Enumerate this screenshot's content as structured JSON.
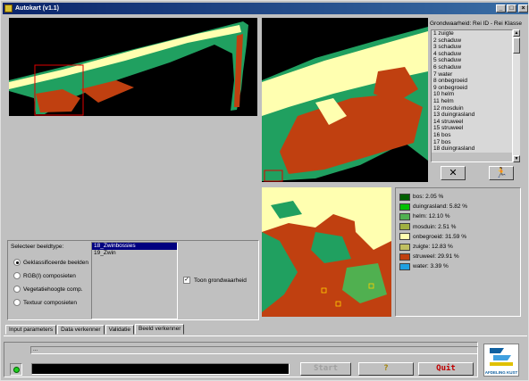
{
  "window": {
    "title": "Autokart (v1.1)",
    "minimize": "_",
    "maximize": "□",
    "close": "×"
  },
  "class_list": {
    "label": "Grondwaarheid: Rei ID - Rei Klasse",
    "items": [
      "1 zuigte",
      "2 schaduw",
      "3 schaduw",
      "4 schaduw",
      "5 schaduw",
      "6 schaduw",
      "7 water",
      "8 onbegroeid",
      "9 onbegroeid",
      "10 helm",
      "11 helm",
      "12 mosduin",
      "13 duingrasland",
      "14 struweel",
      "15 struweel",
      "16 bos",
      "17 bos",
      "18 duingrasland"
    ],
    "clear_button": "✕",
    "run_button": "🏃"
  },
  "legend": {
    "items": [
      {
        "label": "bos: 2.05 %",
        "color": "#006000"
      },
      {
        "label": "duingrasland: 5.82 %",
        "color": "#00c000"
      },
      {
        "label": "helm: 12.10 %",
        "color": "#50b050"
      },
      {
        "label": "mosduin: 2.51 %",
        "color": "#a0b040"
      },
      {
        "label": "onbegroeid: 31.59 %",
        "color": "#ffffb0"
      },
      {
        "label": "zuigte: 12.83 %",
        "color": "#c0c060"
      },
      {
        "label": "struweel: 29.91 %",
        "color": "#c04010"
      },
      {
        "label": "water: 3.39 %",
        "color": "#20a0e0"
      }
    ]
  },
  "selector": {
    "label": "Selecteer beeldtype:",
    "options": [
      "Geklassificeerde beelden",
      "RGB(I) composieten",
      "Vegetatiehoogte comp.",
      "Textuur composieten"
    ],
    "selected_index": 0,
    "images": [
      "18_Zwinbossies",
      "19_Zwin"
    ],
    "selected_image_index": 0,
    "checkbox_label": "Toon grondwaarheid",
    "checkbox_checked": true
  },
  "tabs": [
    "Input parameters",
    "Data verkenner",
    "Validatie",
    "Beeld verkenner"
  ],
  "active_tab": 3,
  "status": {
    "text": "..."
  },
  "buttons": {
    "start": "Start",
    "help": "?",
    "quit": "Quit"
  },
  "logo": {
    "text": "AFDELING KUST"
  }
}
